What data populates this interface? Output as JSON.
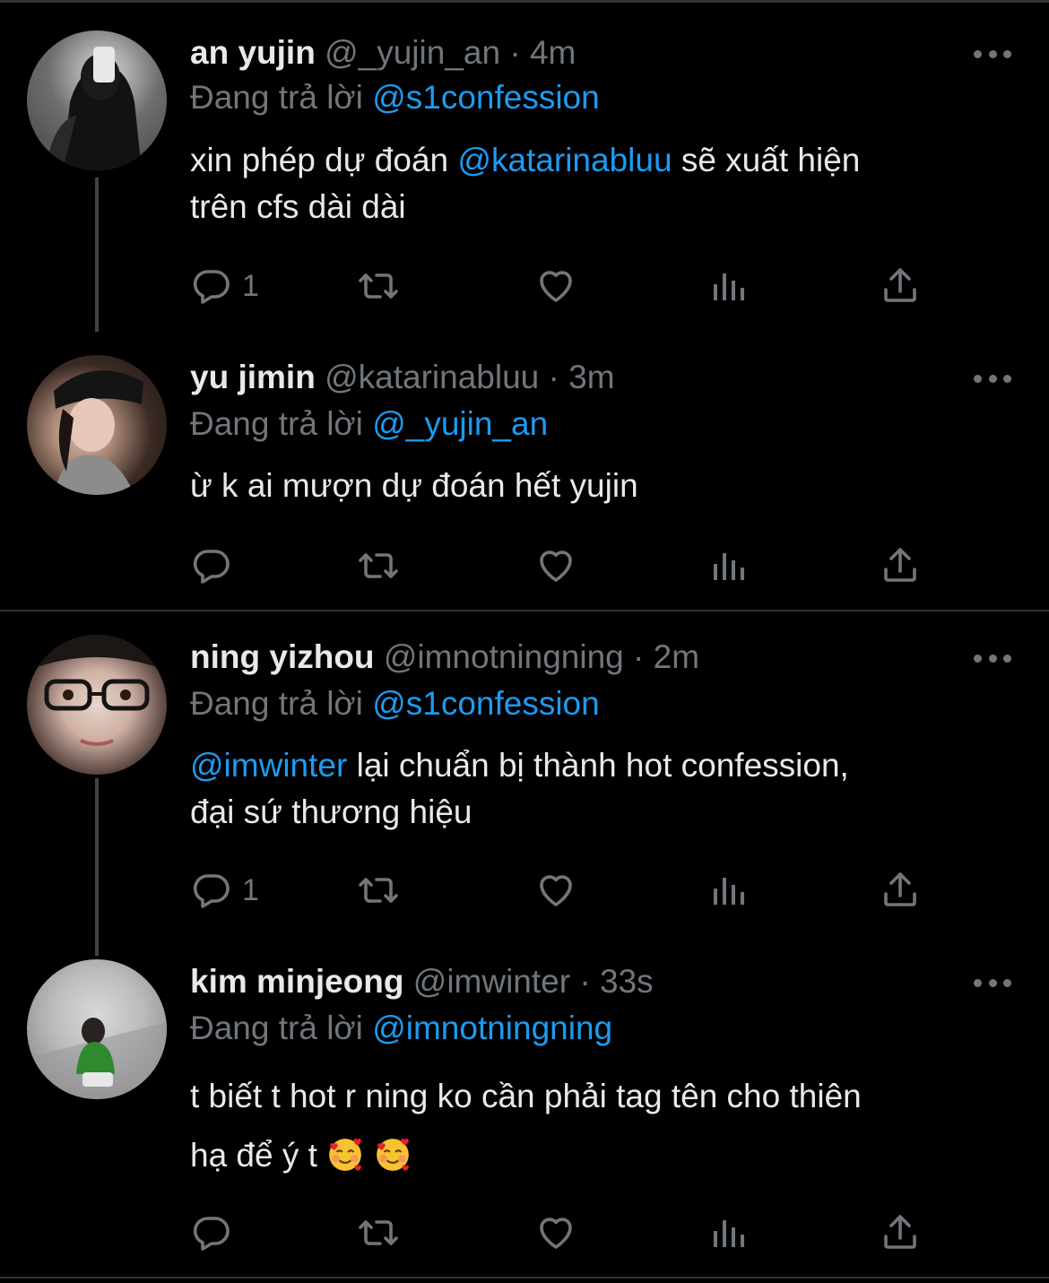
{
  "thread1": {
    "tweets": [
      {
        "name": "an yujin",
        "handle": "@_yujin_an",
        "dot": "·",
        "time": "4m",
        "reply_label": "Đang trả lời",
        "reply_to": "@s1confession",
        "body_line1_a": "xin phép dự đoán ",
        "body_line1_mention": "@katarinabluu",
        "body_line1_b": " sẽ xuất hiện",
        "body_line2": "trên cfs dài dài",
        "reply_count": "1"
      },
      {
        "name": "yu jimin",
        "handle": "@katarinabluu",
        "dot": "·",
        "time": "3m",
        "reply_label": "Đang trả lời",
        "reply_to": "@_yujin_an",
        "body_line1": "ừ k ai mượn dự đoán hết yujin",
        "reply_count": ""
      }
    ]
  },
  "thread2": {
    "tweets": [
      {
        "name": "ning yizhou",
        "handle": "@imnotningning",
        "dot": "·",
        "time": "2m",
        "reply_label": "Đang trả lời",
        "reply_to": "@s1confession",
        "body_line1_mention": "@imwinter",
        "body_line1_b": " lại chuẩn bị thành hot confession,",
        "body_line2": "đại sứ thương hiệu",
        "reply_count": "1"
      },
      {
        "name": "kim minjeong",
        "handle": "@imwinter",
        "dot": "·",
        "time": "33s",
        "reply_label": "Đang trả lời",
        "reply_to": "@imnotningning",
        "body_line1": "t biết t hot r ning ko cần phải tag tên cho thiên",
        "body_line2": "hạ để ý t",
        "emoji": "smiling-face-with-hearts",
        "reply_count": ""
      }
    ]
  },
  "icons": {
    "reply": "reply-icon",
    "retweet": "retweet-icon",
    "like": "like-icon",
    "views": "views-icon",
    "share": "share-icon",
    "more": "more-icon"
  },
  "colors": {
    "background": "#000000",
    "text": "#e7e9ea",
    "muted": "#71767b",
    "link": "#1d9bf0",
    "divider": "#2f3336"
  }
}
